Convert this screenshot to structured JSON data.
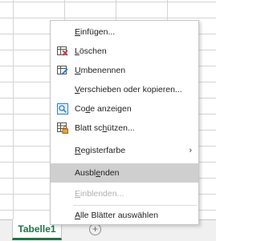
{
  "sheet_tab": {
    "label": "Tabelle1",
    "color": "#217346"
  },
  "add_sheet": {
    "glyph": "+"
  },
  "menu": {
    "items": [
      {
        "pre": "",
        "u": "E",
        "post": "infügen...",
        "icon": "",
        "state": "normal"
      },
      {
        "pre": "",
        "u": "L",
        "post": "öschen",
        "icon": "delete-sheet-icon",
        "state": "normal"
      },
      {
        "pre": "",
        "u": "U",
        "post": "mbenennen",
        "icon": "rename-sheet-icon",
        "state": "normal"
      },
      {
        "pre": "",
        "u": "V",
        "post": "erschieben oder kopieren...",
        "icon": "",
        "state": "normal"
      },
      {
        "pre": "Co",
        "u": "d",
        "post": "e anzeigen",
        "icon": "view-code-icon",
        "state": "normal"
      },
      {
        "pre": "Blatt sc",
        "u": "h",
        "post": "ützen...",
        "icon": "protect-sheet-icon",
        "state": "normal"
      },
      {
        "pre": "",
        "u": "R",
        "post": "egisterfarbe",
        "icon": "",
        "state": "normal",
        "submenu": true
      },
      {
        "pre": "Ausbl",
        "u": "e",
        "post": "nden",
        "icon": "",
        "state": "highlighted"
      },
      {
        "pre": "",
        "u": "E",
        "post": "inblenden...",
        "icon": "",
        "state": "disabled"
      },
      {
        "pre": "",
        "u": "A",
        "post": "lle Blätter auswählen",
        "icon": "",
        "state": "normal"
      }
    ],
    "submenu_glyph": "›"
  }
}
